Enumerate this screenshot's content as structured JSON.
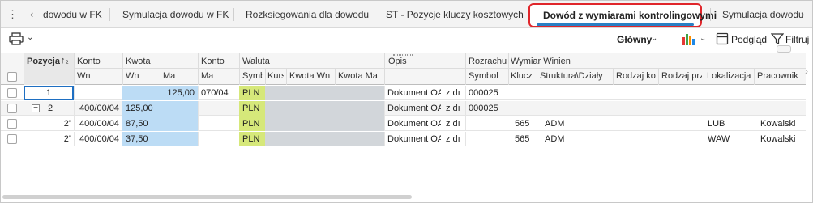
{
  "tabs": {
    "items": [
      {
        "label": "dowodu w FK"
      },
      {
        "label": "Symulacja dowodu w FK"
      },
      {
        "label": "Rozksiegowania dla dowodu"
      },
      {
        "label": "ST - Pozycje kluczy kosztowych"
      },
      {
        "label": "Dowód z wymiarami kontrolingowymi"
      },
      {
        "label": "Symulacja dowodu"
      }
    ],
    "active_index": 4
  },
  "toolbar": {
    "view_select": "Główny",
    "preview_label": "Podgląd",
    "filter_label": "Filtruj"
  },
  "grid": {
    "headers_top": {
      "pozycja": "Pozycja",
      "konto_wn": "Konto",
      "kwota": "Kwota",
      "konto_ma": "Konto",
      "waluta": "Waluta",
      "opis": "Opis",
      "rozrachunek": "Rozrachu",
      "wymiar": "Wymiar Winien"
    },
    "headers_bottom": {
      "konto_wn_sub": "Wn",
      "kwota_wn": "Wn",
      "kwota_ma": "Ma",
      "konto_ma_sub": "Ma",
      "symbol": "Symb",
      "kurs": "Kurs",
      "kwota_wal_wn": "Kwota Wn",
      "kwota_wal_ma": "Kwota Ma",
      "rozr_symbol": "Symbol",
      "klucz": "Klucz",
      "struktura": "Struktura\\Działy",
      "rodzaj_kosztu": "Rodzaj ko",
      "rodzaj_przych": "Rodzaj prz",
      "lokalizacja": "Lokalizacja",
      "pracownik": "Pracownik"
    },
    "rows": [
      {
        "pozycja": "1",
        "konto_wn": "",
        "kwota_wn": "",
        "kwota_ma": "125,00",
        "konto_ma": "070/04",
        "waluta": "PLN",
        "opis_a": "Dokument OA",
        "opis_b": "z dı",
        "rozr": "000025",
        "klucz": "",
        "struktura": "",
        "lokalizacja": "",
        "pracownik": ""
      },
      {
        "pozycja": "2",
        "konto_wn": "400/00/04",
        "kwota_wn": "125,00",
        "kwota_ma": "",
        "konto_ma": "",
        "waluta": "PLN",
        "opis_a": "Dokument OA",
        "opis_b": "z dı",
        "rozr": "000025",
        "klucz": "",
        "struktura": "",
        "lokalizacja": "",
        "pracownik": ""
      },
      {
        "pozycja": "2'",
        "konto_wn": "400/00/04",
        "kwota_wn": "87,50",
        "kwota_ma": "",
        "konto_ma": "",
        "waluta": "PLN",
        "opis_a": "Dokument OA",
        "opis_b": "z dı",
        "rozr": "",
        "klucz": "565",
        "struktura": "ADM",
        "lokalizacja": "LUB",
        "pracownik": "Kowalski"
      },
      {
        "pozycja": "2'",
        "konto_wn": "400/00/04",
        "kwota_wn": "37,50",
        "kwota_ma": "",
        "konto_ma": "",
        "waluta": "PLN",
        "opis_a": "Dokument OA",
        "opis_b": "z dı",
        "rozr": "",
        "klucz": "565",
        "struktura": "ADM",
        "lokalizacja": "WAW",
        "pracownik": "Kowalski"
      }
    ]
  },
  "colors": {
    "active_tab_border": "#e0262b",
    "active_tab_underline": "#2a7fc4",
    "amount_highlight": "#bcdcf5",
    "currency_highlight": "#d6e87a",
    "disabled_cells": "#d2d6da"
  }
}
